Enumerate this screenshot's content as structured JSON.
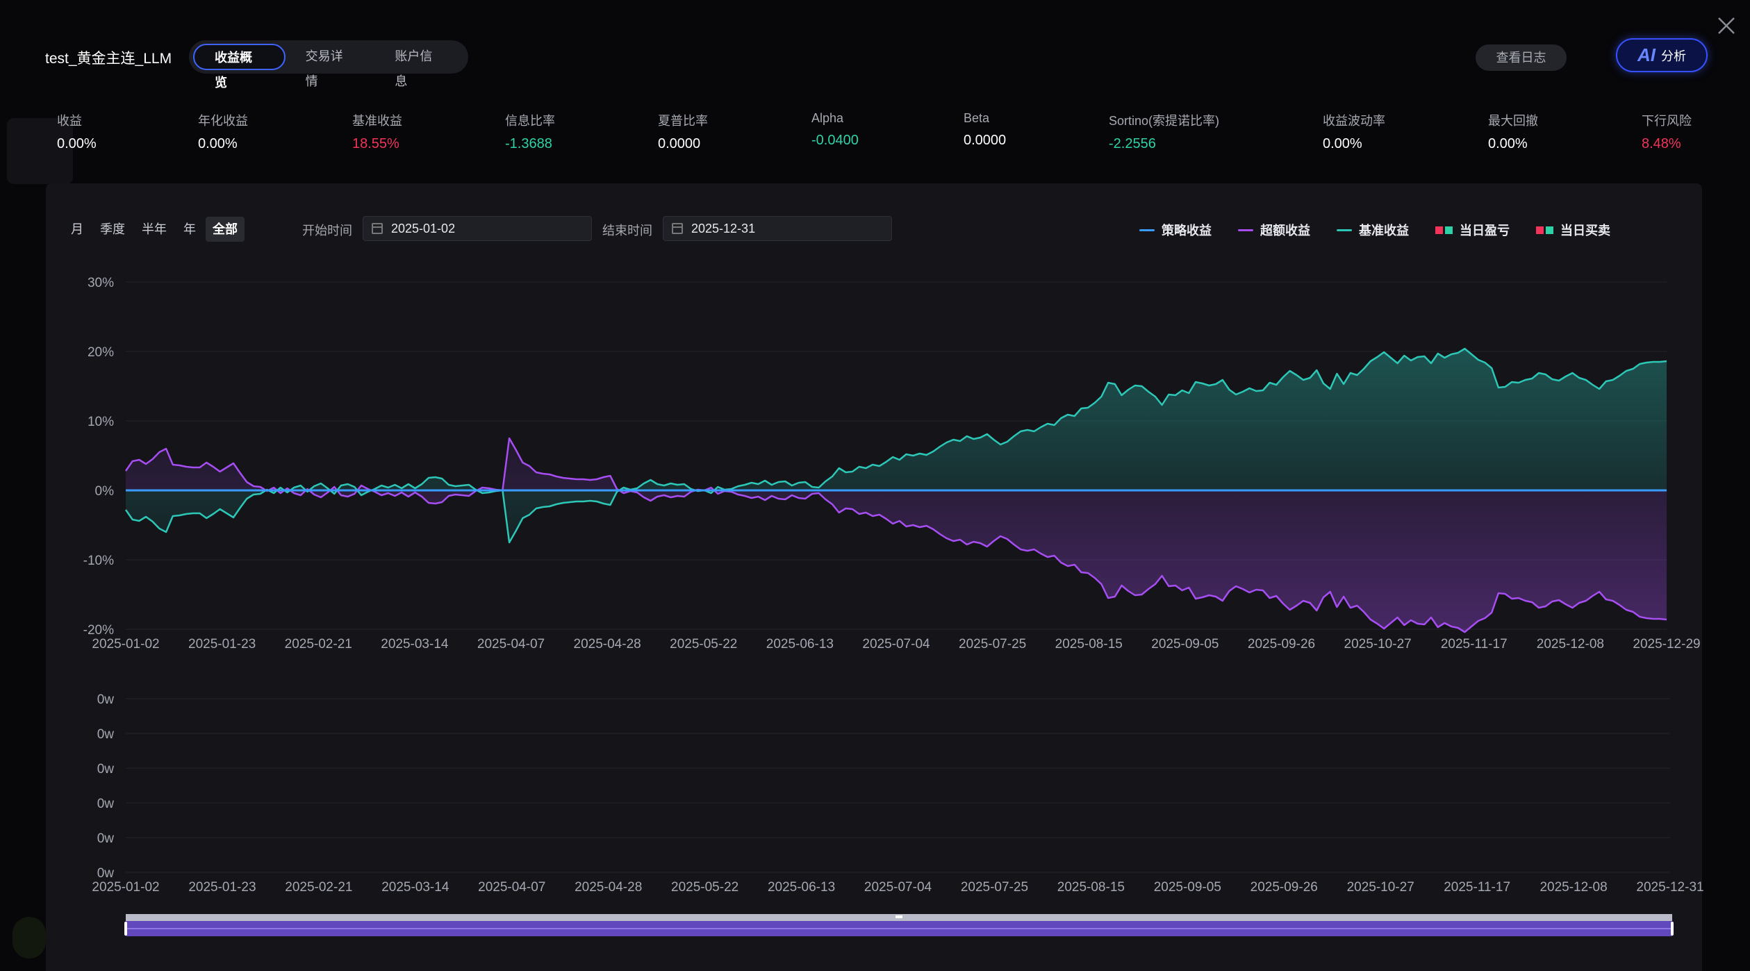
{
  "header": {
    "title": "test_黄金主连_LLM",
    "tabs": [
      {
        "label": "收益概览",
        "active": true
      },
      {
        "label": "交易详情",
        "active": false
      },
      {
        "label": "账户信息",
        "active": false
      }
    ],
    "log_button": "查看日志",
    "ai_button": {
      "mark": "AI",
      "label": "分析"
    }
  },
  "metrics": [
    {
      "label": "收益",
      "value": "0.00%",
      "tone": "white"
    },
    {
      "label": "年化收益",
      "value": "0.00%",
      "tone": "white"
    },
    {
      "label": "基准收益",
      "value": "18.55%",
      "tone": "red"
    },
    {
      "label": "信息比率",
      "value": "-1.3688",
      "tone": "green"
    },
    {
      "label": "夏普比率",
      "value": "0.0000",
      "tone": "white"
    },
    {
      "label": "Alpha",
      "value": "-0.0400",
      "tone": "green"
    },
    {
      "label": "Beta",
      "value": "0.0000",
      "tone": "white"
    },
    {
      "label": "Sortino(索提诺比率)",
      "value": "-2.2556",
      "tone": "green"
    },
    {
      "label": "收益波动率",
      "value": "0.00%",
      "tone": "white"
    },
    {
      "label": "最大回撤",
      "value": "0.00%",
      "tone": "white"
    },
    {
      "label": "下行风险",
      "value": "8.48%",
      "tone": "red"
    }
  ],
  "controls": {
    "ranges": [
      {
        "label": "月",
        "active": false
      },
      {
        "label": "季度",
        "active": false
      },
      {
        "label": "半年",
        "active": false
      },
      {
        "label": "年",
        "active": false
      },
      {
        "label": "全部",
        "active": true
      }
    ],
    "start_label": "开始时间",
    "start_value": "2025-01-02",
    "end_label": "结束时间",
    "end_value": "2025-12-31"
  },
  "colors": {
    "strategy": "#3b9cff",
    "excess": "#a64ef2",
    "benchmark": "#2dc7b7",
    "profit_red": "#f0345a",
    "profit_green": "#2fd2a6",
    "accent": "#3e63ff"
  },
  "chart_data": [
    {
      "type": "line",
      "legend": [
        {
          "name": "策略收益",
          "kind": "line",
          "color": "#3b9cff"
        },
        {
          "name": "超额收益",
          "kind": "line",
          "color": "#a64ef2"
        },
        {
          "name": "基准收益",
          "kind": "line",
          "color": "#2dc7b7"
        },
        {
          "name": "当日盈亏",
          "kind": "squares"
        },
        {
          "name": "当日买卖",
          "kind": "squares"
        }
      ],
      "legend_position": "top-right",
      "ylim": [
        -20,
        30
      ],
      "y_ticks": [
        "30%",
        "20%",
        "10%",
        "0%",
        "-10%",
        "-20%"
      ],
      "x_ticks": [
        "2025-01-02",
        "2025-01-23",
        "2025-02-21",
        "2025-03-14",
        "2025-04-07",
        "2025-04-28",
        "2025-05-22",
        "2025-06-13",
        "2025-07-04",
        "2025-07-25",
        "2025-08-15",
        "2025-09-05",
        "2025-09-26",
        "2025-10-27",
        "2025-11-17",
        "2025-12-08",
        "2025-12-29"
      ],
      "series": [
        {
          "name": "策略收益",
          "values": [
            0,
            0
          ]
        },
        {
          "name": "基准收益",
          "values": [
            -2.8,
            -4.2,
            -4.4,
            -3.8,
            -4.5,
            -5.5,
            -6.0,
            -3.7,
            -3.6,
            -3.4,
            -3.3,
            -3.3,
            -4.0,
            -3.4,
            -2.7,
            -3.3,
            -3.9,
            -2.5,
            -1.2,
            -0.6,
            -0.5,
            0.1,
            -0.4,
            0.4,
            -0.3,
            0.4,
            0.7,
            -0.2,
            0.6,
            1.0,
            0.3,
            -0.5,
            0.7,
            0.9,
            0.5,
            -0.7,
            -0.2,
            0.2,
            0.7,
            0.4,
            0.8,
            0.3,
            0.9,
            0.3,
            0.9,
            1.8,
            1.9,
            1.7,
            0.8,
            0.6,
            0.7,
            0.8,
            0.1,
            -0.4,
            -0.3,
            -0.1,
            0.0,
            -7.5,
            -5.8,
            -4.0,
            -3.5,
            -2.6,
            -2.4,
            -2.3,
            -2.0,
            -1.8,
            -1.7,
            -1.6,
            -1.6,
            -1.5,
            -1.6,
            -1.9,
            -2.1,
            -0.2,
            0.4,
            0.1,
            0.3,
            1.0,
            1.5,
            0.9,
            0.7,
            1.0,
            0.8,
            0.9,
            0.2,
            -0.1,
            0.0,
            -0.4,
            0.5,
            0.1,
            0.2,
            0.6,
            0.8,
            1.1,
            0.9,
            1.4,
            0.8,
            1.2,
            1.3,
            0.7,
            1.1,
            1.2,
            0.5,
            0.4,
            1.3,
            2.0,
            3.2,
            2.6,
            2.7,
            3.4,
            3.2,
            3.7,
            3.5,
            4.1,
            4.8,
            4.4,
            5.2,
            5.0,
            5.3,
            5.1,
            5.6,
            6.3,
            6.9,
            7.3,
            7.1,
            7.8,
            7.4,
            7.6,
            8.1,
            7.3,
            6.6,
            7.0,
            7.8,
            8.5,
            8.7,
            8.5,
            9.1,
            9.6,
            9.4,
            10.4,
            10.9,
            10.7,
            11.8,
            11.9,
            12.6,
            13.5,
            15.5,
            15.3,
            13.7,
            14.5,
            15.1,
            15.0,
            14.2,
            13.5,
            12.3,
            13.8,
            13.7,
            14.4,
            14.0,
            15.6,
            15.4,
            15.1,
            15.3,
            15.9,
            14.5,
            13.8,
            14.2,
            14.7,
            14.3,
            14.4,
            15.5,
            15.2,
            16.3,
            17.2,
            16.6,
            15.9,
            16.2,
            17.3,
            15.4,
            14.6,
            16.8,
            15.3,
            16.9,
            16.6,
            17.5,
            18.6,
            19.2,
            19.9,
            19.1,
            18.3,
            19.4,
            18.7,
            19.2,
            19.3,
            18.3,
            19.7,
            19.1,
            19.6,
            19.8,
            20.4,
            19.6,
            18.8,
            18.4,
            17.6,
            14.8,
            14.9,
            15.6,
            15.5,
            15.9,
            16.1,
            16.9,
            16.7,
            16.0,
            15.8,
            16.4,
            16.9,
            16.2,
            15.9,
            15.2,
            14.6,
            15.7,
            15.9,
            16.5,
            17.2,
            17.5,
            18.2,
            18.4,
            18.5,
            18.5,
            18.6
          ]
        },
        {
          "name": "超额收益",
          "values": [
            2.8,
            4.2,
            4.4,
            3.8,
            4.5,
            5.5,
            6.0,
            3.7,
            3.6,
            3.4,
            3.3,
            3.3,
            4.0,
            3.4,
            2.7,
            3.3,
            3.9,
            2.5,
            1.2,
            0.6,
            0.5,
            -0.1,
            0.4,
            -0.4,
            0.3,
            -0.4,
            -0.7,
            0.2,
            -0.6,
            -1.0,
            -0.3,
            0.5,
            -0.7,
            -0.9,
            -0.5,
            0.7,
            0.2,
            -0.2,
            -0.7,
            -0.4,
            -0.8,
            -0.3,
            -0.9,
            -0.3,
            -0.9,
            -1.8,
            -1.9,
            -1.7,
            -0.8,
            -0.6,
            -0.7,
            -0.8,
            -0.1,
            0.4,
            0.3,
            0.1,
            0.0,
            7.5,
            5.8,
            4.0,
            3.5,
            2.6,
            2.4,
            2.3,
            2.0,
            1.8,
            1.7,
            1.6,
            1.6,
            1.5,
            1.6,
            1.9,
            2.1,
            0.2,
            -0.4,
            -0.1,
            -0.3,
            -1.0,
            -1.5,
            -0.9,
            -0.7,
            -1.0,
            -0.8,
            -0.9,
            -0.2,
            0.1,
            0.0,
            0.4,
            -0.5,
            -0.1,
            -0.2,
            -0.6,
            -0.8,
            -1.1,
            -0.9,
            -1.4,
            -0.8,
            -1.2,
            -1.3,
            -0.7,
            -1.1,
            -1.2,
            -0.5,
            -0.4,
            -1.3,
            -2.0,
            -3.2,
            -2.6,
            -2.7,
            -3.4,
            -3.2,
            -3.7,
            -3.5,
            -4.1,
            -4.8,
            -4.4,
            -5.2,
            -5.0,
            -5.3,
            -5.1,
            -5.6,
            -6.3,
            -6.9,
            -7.3,
            -7.1,
            -7.8,
            -7.4,
            -7.6,
            -8.1,
            -7.3,
            -6.6,
            -7.0,
            -7.8,
            -8.5,
            -8.7,
            -8.5,
            -9.1,
            -9.6,
            -9.4,
            -10.4,
            -10.9,
            -10.7,
            -11.8,
            -11.9,
            -12.6,
            -13.5,
            -15.5,
            -15.3,
            -13.7,
            -14.5,
            -15.1,
            -15.0,
            -14.2,
            -13.5,
            -12.3,
            -13.8,
            -13.7,
            -14.4,
            -14.0,
            -15.6,
            -15.4,
            -15.1,
            -15.3,
            -15.9,
            -14.5,
            -13.8,
            -14.2,
            -14.7,
            -14.3,
            -14.4,
            -15.5,
            -15.2,
            -16.3,
            -17.2,
            -16.6,
            -15.9,
            -16.2,
            -17.3,
            -15.4,
            -14.6,
            -16.8,
            -15.3,
            -16.9,
            -16.6,
            -17.5,
            -18.6,
            -19.2,
            -19.9,
            -19.1,
            -18.3,
            -19.4,
            -18.7,
            -19.2,
            -19.3,
            -18.3,
            -19.7,
            -19.1,
            -19.6,
            -19.8,
            -20.4,
            -19.6,
            -18.8,
            -18.4,
            -17.6,
            -14.8,
            -14.9,
            -15.6,
            -15.5,
            -15.9,
            -16.1,
            -16.9,
            -16.7,
            -16.0,
            -15.8,
            -16.4,
            -16.9,
            -16.2,
            -15.9,
            -15.2,
            -14.6,
            -15.7,
            -15.9,
            -16.5,
            -17.2,
            -17.5,
            -18.2,
            -18.4,
            -18.5,
            -18.5,
            -18.6
          ]
        }
      ]
    },
    {
      "type": "bar",
      "y_ticks": [
        "0w",
        "0w",
        "0w",
        "0w",
        "0w",
        "0w"
      ],
      "x_ticks": [
        "2025-01-02",
        "2025-01-23",
        "2025-02-21",
        "2025-03-14",
        "2025-04-07",
        "2025-04-28",
        "2025-05-22",
        "2025-06-13",
        "2025-07-04",
        "2025-07-25",
        "2025-08-15",
        "2025-09-05",
        "2025-09-26",
        "2025-10-27",
        "2025-11-17",
        "2025-12-08",
        "2025-12-31"
      ],
      "series": []
    }
  ],
  "slider": {
    "start_percent": 0,
    "end_percent": 100
  }
}
